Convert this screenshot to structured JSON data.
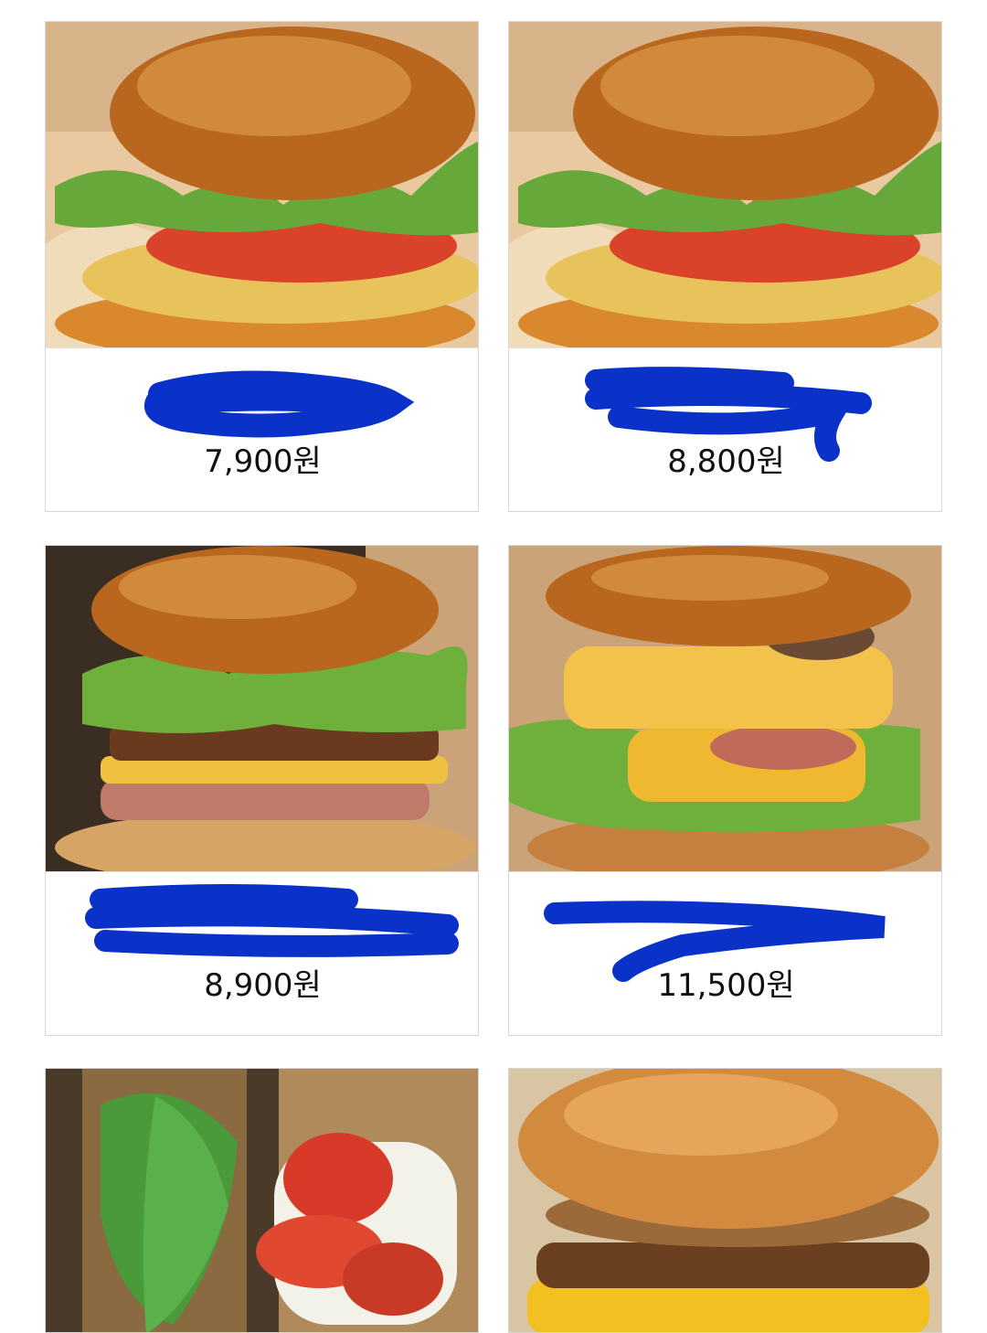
{
  "menu_items": [
    {
      "name": "",
      "price": "7,900원",
      "image": "burger-lettuce-tomato"
    },
    {
      "name": "",
      "price": "8,800원",
      "image": "burger-lettuce-tomato"
    },
    {
      "name": "",
      "price": "8,900원",
      "image": "burger-bacon-cheese"
    },
    {
      "name": "",
      "price": "11,500원",
      "image": "double-burger-bacon"
    },
    {
      "name": "",
      "price": "",
      "image": "open-sandwich-arugula-tomato"
    },
    {
      "name": "",
      "price": "",
      "image": "burger-caramelized-onion"
    }
  ],
  "colors": {
    "redaction": "#0a32c8",
    "card_border": "#d6d6d6"
  }
}
